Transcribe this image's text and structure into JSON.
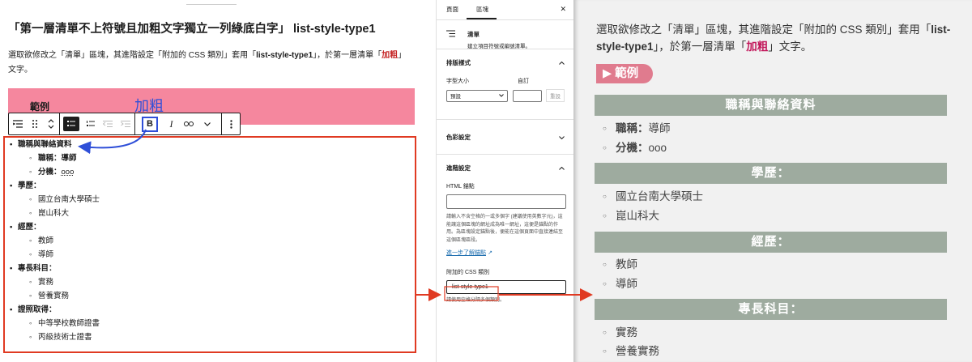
{
  "editor": {
    "title": "「第一層清單不上符號且加粗文字獨立一列綠底白字」 list-style-type1",
    "desc_pre": "選取欲修改之「清單」區塊，其進階設定「附加的 CSS 類別」套用「",
    "desc_class": "list-style-type1",
    "desc_mid": "」，於第一層清單「",
    "desc_bold": "加粗",
    "desc_post": "」文字。",
    "block_label": "範例",
    "callout": "加粗",
    "toolbar": {
      "bold": "B",
      "italic": "I"
    },
    "list": [
      {
        "text": "職稱與聯絡資料",
        "level": 1
      },
      {
        "key": "職稱：",
        "value": "導師",
        "level": 2,
        "bold": true
      },
      {
        "key": "分機：",
        "value": "ooo",
        "level": 2,
        "bold": true
      },
      {
        "text": "學歷：",
        "level": 1
      },
      {
        "text": "國立台南大學碩士",
        "level": 2
      },
      {
        "text": "崑山科大",
        "level": 2
      },
      {
        "text": "經歷：",
        "level": 1
      },
      {
        "text": "教師",
        "level": 2
      },
      {
        "text": "導師",
        "level": 2
      },
      {
        "text": "專長科目：",
        "level": 1
      },
      {
        "text": "實務",
        "level": 2
      },
      {
        "text": "營養實務",
        "level": 2
      },
      {
        "text": "證照取得：",
        "level": 1
      },
      {
        "text": "中等學校教師證書",
        "level": 2
      },
      {
        "text": "丙級技術士證書",
        "level": 2
      }
    ]
  },
  "sidebar": {
    "tabs": [
      "頁面",
      "區塊"
    ],
    "block_name": "清單",
    "block_desc": "建立項目符號或編號清單。",
    "typography": {
      "title": "排版樣式",
      "font_size_label": "字型大小",
      "custom_label": "自訂",
      "font_size_value": "預設",
      "reset": "重設"
    },
    "color": {
      "title": "色彩設定"
    },
    "advanced": {
      "title": "進階設定",
      "anchor_label": "HTML 錨點",
      "anchor_help": "請輸入不含空格的一或多個字 (建議使用英數字元)，這能讓這個區塊的網址成為唯一網址，這便是錨點的作用。為區塊設定錨點後，便能在這個頁面中直接連結至這個區塊區段。",
      "learn_more": "進一步了解錨點",
      "css_label": "附加的 CSS 類別",
      "css_value": "list-style-type1",
      "css_help": "請使用空格分隔多個類別。"
    }
  },
  "preview": {
    "desc_pre": "選取欲修改之「清單」區塊，其進階設定「附加的 CSS 類別」套用「",
    "desc_class": "list-style-type1",
    "desc_mid": "」，於第一層清單「",
    "desc_bold": "加粗",
    "desc_post": "」文字。",
    "badge": "▶ 範例",
    "sections": [
      {
        "title": "職稱與聯絡資料",
        "items": [
          {
            "k": "職稱：",
            "v": "導師"
          },
          {
            "k": "分機：",
            "v": "ooo"
          }
        ]
      },
      {
        "title": "學歷：",
        "items": [
          {
            "v": "國立台南大學碩士"
          },
          {
            "v": "崑山科大"
          }
        ]
      },
      {
        "title": "經歷：",
        "items": [
          {
            "v": "教師"
          },
          {
            "v": "導師"
          }
        ]
      },
      {
        "title": "專長科目：",
        "items": [
          {
            "v": "實務"
          },
          {
            "v": "營養實務"
          }
        ]
      }
    ]
  },
  "colors": {
    "highlight_red": "#e03a22",
    "callout_blue": "#2f4fd8",
    "pink_block": "#f5879e",
    "preview_heading": "#9eab9f",
    "badge": "#e07b8e"
  }
}
